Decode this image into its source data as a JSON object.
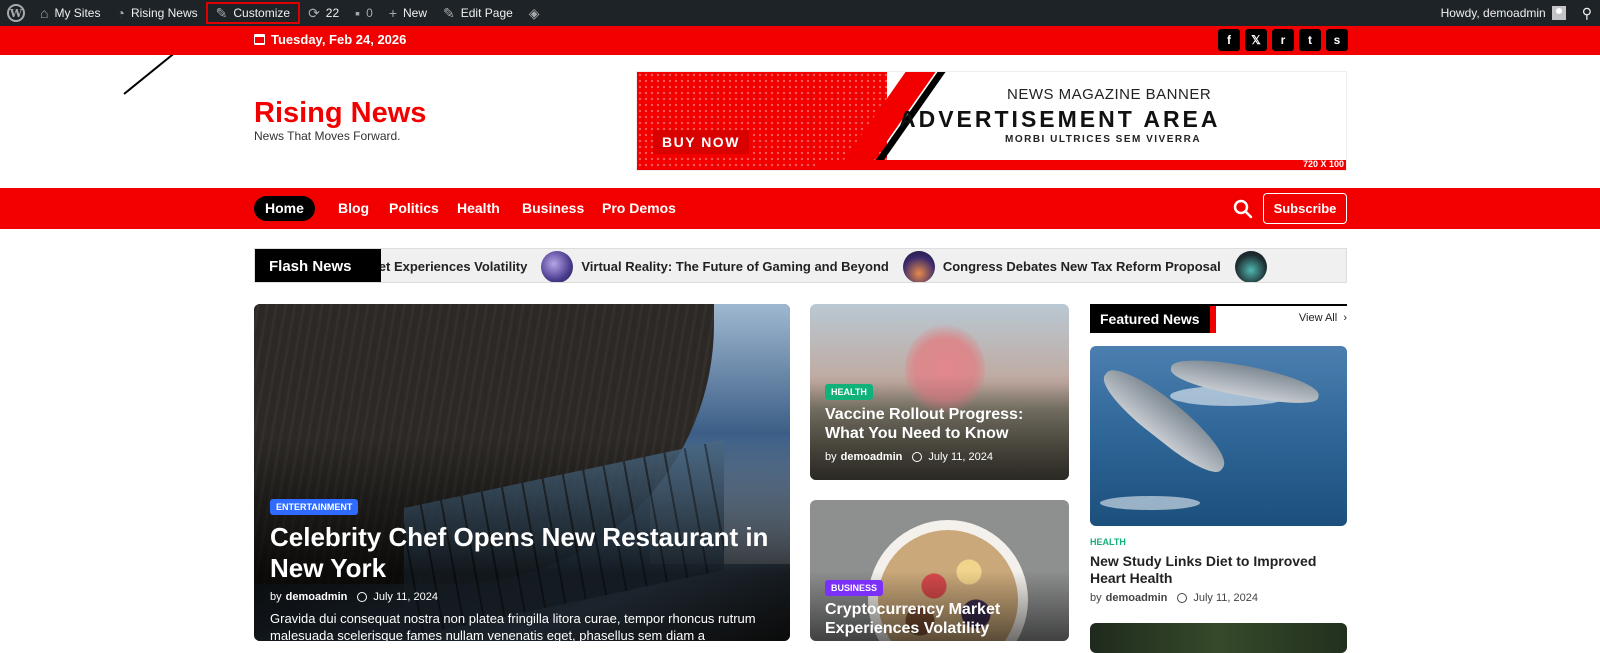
{
  "admin_bar": {
    "my_sites": "My Sites",
    "site_name": "Rising News",
    "customize": "Customize",
    "updates_count": "22",
    "comments_count": "0",
    "new_label": "New",
    "edit_page": "Edit Page",
    "howdy": "Howdy, demoadmin"
  },
  "topbar": {
    "date": "Tuesday, Feb 24, 2026",
    "socials": [
      "f",
      "𝕏",
      "r",
      "t",
      "s"
    ]
  },
  "header": {
    "title": "Rising News",
    "tagline": "News That Moves Forward."
  },
  "ad": {
    "buy_now": "BUY NOW",
    "line1": "NEWS MAGAZINE BANNER",
    "line2": "ADVERTISEMENT AREA",
    "line3": "MORBI ULTRICES SEM VIVERRA",
    "size": "720 X 100"
  },
  "nav": {
    "items": [
      "Home",
      "Blog",
      "Politics",
      "Health",
      "Business",
      "Pro Demos"
    ],
    "subscribe": "Subscribe"
  },
  "flash": {
    "label": "Flash News",
    "items": [
      "Cryptocurrency Market Experiences Volatility",
      "Virtual Reality: The Future of Gaming and Beyond",
      "Congress Debates New Tax Reform Proposal"
    ]
  },
  "main_story": {
    "category": "ENTERTAINMENT",
    "title": "Celebrity Chef Opens New Restaurant in New York",
    "by": "by",
    "author": "demoadmin",
    "date": "July 11, 2024",
    "excerpt": "Gravida dui consequat nostra non platea fringilla litora curae, tempor rhoncus rutrum malesuada scelerisque fames nullam venenatis eget, phasellus sem diam a"
  },
  "story_2": {
    "category": "HEALTH",
    "title": "Vaccine Rollout Progress: What You Need to Know",
    "by": "by",
    "author": "demoadmin",
    "date": "July 11, 2024"
  },
  "story_3": {
    "category": "BUSINESS",
    "title": "Cryptocurrency Market Experiences Volatility"
  },
  "featured": {
    "heading": "Featured News",
    "view_all": "View All",
    "category": "HEALTH",
    "title": "New Study Links Diet to Improved Heart Health",
    "by": "by",
    "author": "demoadmin",
    "date": "July 11, 2024"
  },
  "colors": {
    "brand_red": "#f20000",
    "admin_bar": "#1d2327",
    "health_badge": "#11b27a",
    "entertainment_badge": "#2f6bff",
    "business_badge": "#7b2ff7"
  }
}
